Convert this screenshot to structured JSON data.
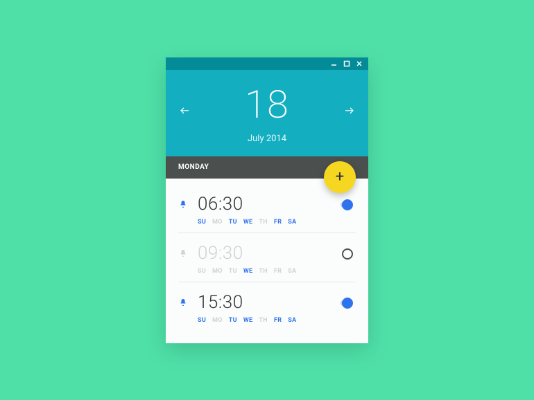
{
  "header": {
    "day": "18",
    "month_year": "July 2014"
  },
  "dow_label": "MONDAY",
  "fab_label": "+",
  "day_labels": [
    "SU",
    "MO",
    "TU",
    "WE",
    "TH",
    "FR",
    "SA"
  ],
  "alarms": [
    {
      "time": "06:30",
      "enabled": true,
      "days_active": [
        true,
        false,
        true,
        true,
        false,
        true,
        true
      ]
    },
    {
      "time": "09:30",
      "enabled": false,
      "days_active": [
        false,
        false,
        false,
        true,
        false,
        false,
        false
      ]
    },
    {
      "time": "15:30",
      "enabled": true,
      "days_active": [
        true,
        false,
        true,
        true,
        false,
        true,
        true
      ]
    }
  ],
  "colors": {
    "accent": "#2f72ed",
    "header": "#14aec1",
    "titlebar": "#038b97",
    "fab": "#f5d722",
    "dowbar": "#4b4f4e",
    "bg": "#4fe0a8"
  }
}
